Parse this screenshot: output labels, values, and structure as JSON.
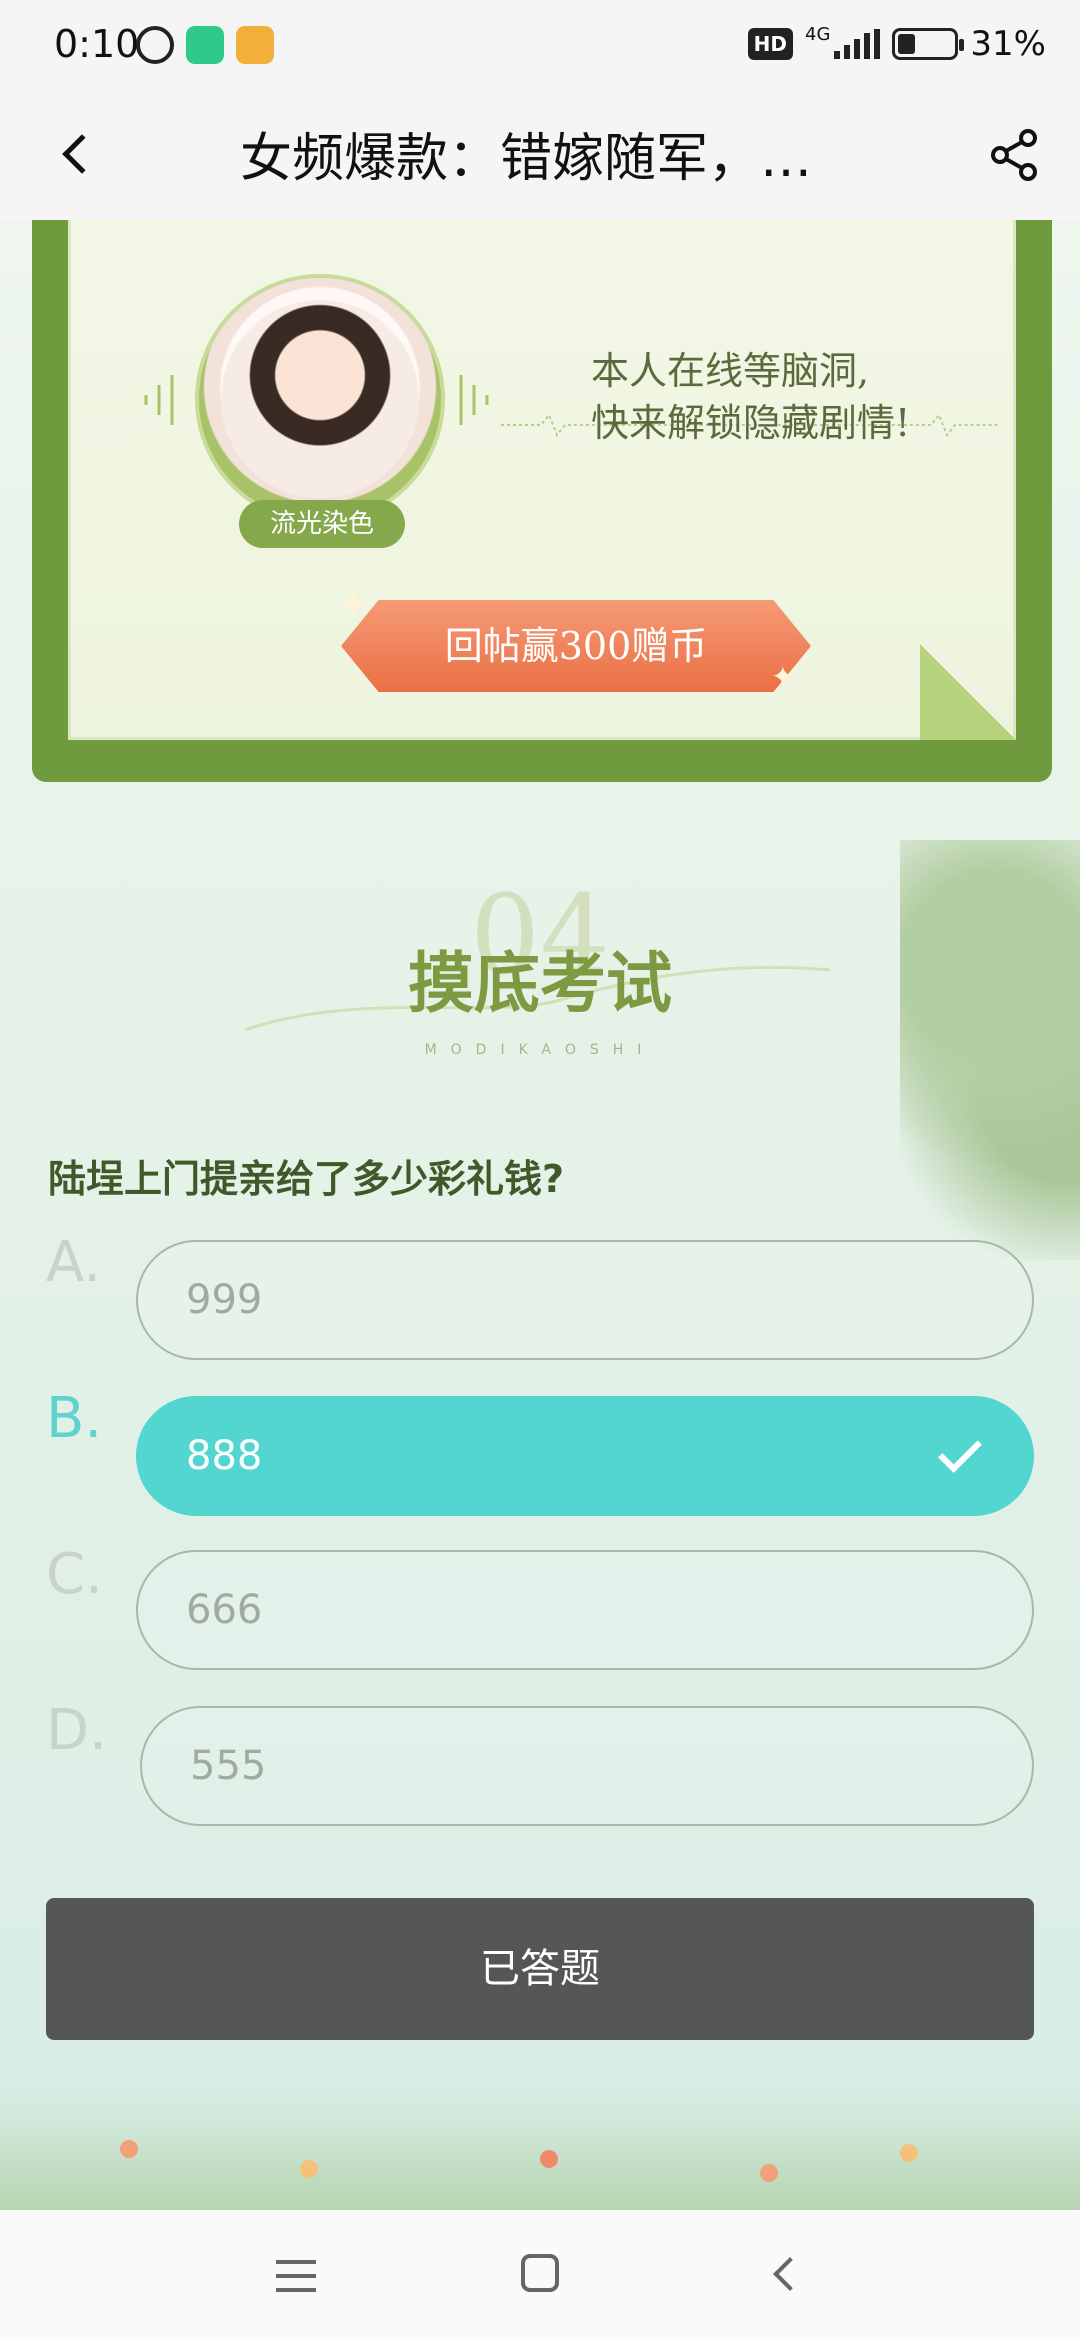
{
  "status_bar": {
    "time": "0:10",
    "hd": "HD",
    "network": "4G",
    "battery_percent": "31%",
    "battery_level": 0.31,
    "icons": [
      "alarm-icon",
      "shield-app-icon",
      "weibo-app-icon",
      "signal-icon",
      "battery-icon"
    ]
  },
  "header": {
    "title": "女频爆款：错嫁随军，…",
    "back_icon": "chevron-left-icon",
    "share_icon": "share-icon"
  },
  "promo": {
    "author_name": "流光染色",
    "message_line1": "本人在线等脑洞,",
    "message_line2": "快来解锁隐藏剧情!",
    "button_label": "回帖赢300赠币"
  },
  "section": {
    "number": "04",
    "title": "摸底考试",
    "subtitle": "MODIKAOSHI"
  },
  "quiz": {
    "question": "陆埕上门提亲给了多少彩礼钱?",
    "selected": "B",
    "options": [
      {
        "letter": "A.",
        "text": "999"
      },
      {
        "letter": "B.",
        "text": "888"
      },
      {
        "letter": "C.",
        "text": "666"
      },
      {
        "letter": "D.",
        "text": "555"
      }
    ],
    "submit_label": "已答题"
  },
  "colors": {
    "accent": "#52d6cf",
    "promo_green": "#6f9a3d",
    "promo_button": "#ea6f45",
    "answered_button": "#555755"
  },
  "nav": {
    "icons": [
      "menu-icon",
      "home-icon",
      "back-icon"
    ]
  }
}
